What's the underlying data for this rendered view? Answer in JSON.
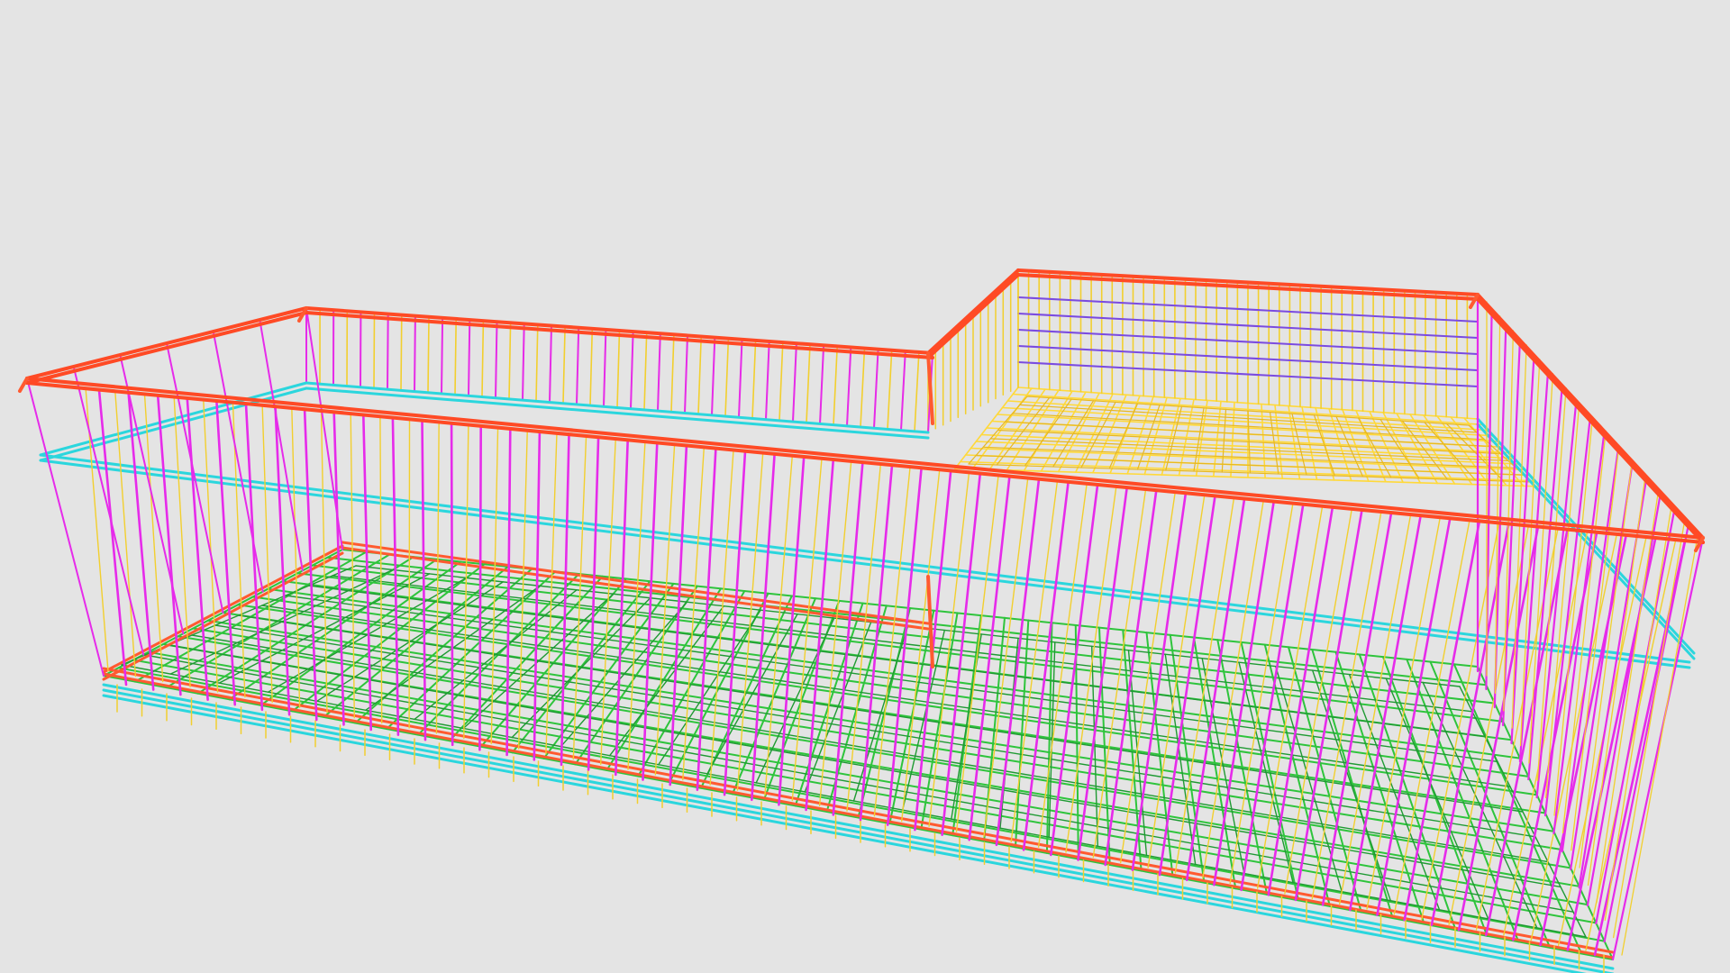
{
  "viewport": {
    "background": "#e4e4e4"
  },
  "palette": {
    "top_perimeter": "#ff4a25",
    "hook_bar": "#ff5a30",
    "vertical_stirrup": "#e62bea",
    "mid_perimeter": "#2bd6dd",
    "inner_stirrup": "#f2cf2e",
    "bottom_mesh": "#2ec43c",
    "bottom_mesh_dark": "#1f9a33",
    "top_mesh": "#ffd93a",
    "back_wall_bar": "#7a4be0",
    "transition": "#8fe04a"
  },
  "model": {
    "name": "rebar-cage-wireframe",
    "views": [
      "perspective"
    ]
  }
}
